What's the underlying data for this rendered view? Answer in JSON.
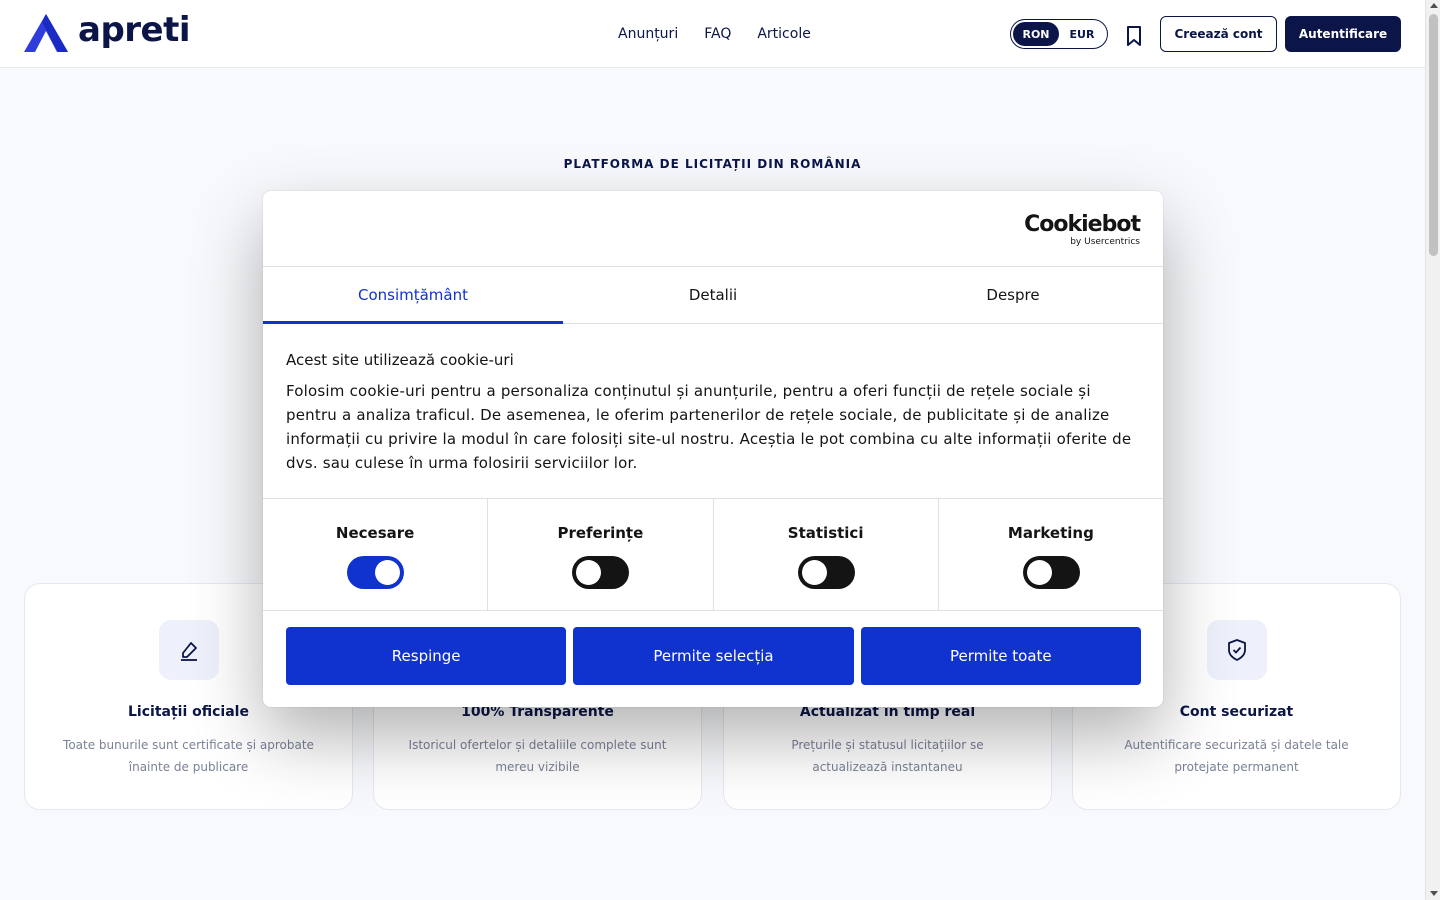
{
  "header": {
    "logo_text": "apreti",
    "nav": [
      "Anunțuri",
      "FAQ",
      "Articole"
    ],
    "currency": [
      "RON",
      "EUR"
    ],
    "currency_selected": "RON",
    "create_account": "Creează cont",
    "login": "Autentificare"
  },
  "hero": {
    "tagline": "PLATFORMA DE LICITAȚII DIN ROMÂNIA"
  },
  "features": [
    {
      "icon": "pen-icon",
      "title": "Licitații oficiale",
      "desc": "Toate bunurile sunt certificate și aprobate înainte de publicare"
    },
    {
      "icon": "eye-icon",
      "title": "100% Transparente",
      "desc": "Istoricul ofertelor și detaliile complete sunt mereu vizibile"
    },
    {
      "icon": "clock-icon",
      "title": "Actualizat în timp real",
      "desc": "Prețurile și statusul licitațiilor se actualizează instantaneu"
    },
    {
      "icon": "shield-check-icon",
      "title": "Cont securizat",
      "desc": "Autentificare securizată și datele tale protejate permanent"
    }
  ],
  "cookie": {
    "brand": "Cookiebot",
    "brand_sub": "by Usercentrics",
    "tabs": [
      "Consimțământ",
      "Detalii",
      "Despre"
    ],
    "active_tab": "Consimțământ",
    "heading": "Acest site utilizează cookie-uri",
    "text": "Folosim cookie-uri pentru a personaliza conținutul și anunțurile, pentru a oferi funcții de rețele sociale și pentru a analiza traficul. De asemenea, le oferim partenerilor de rețele sociale, de publicitate și de analize informații cu privire la modul în care folosiți site-ul nostru. Aceștia le pot combina cu alte informații oferite de dvs. sau culese în urma folosirii serviciilor lor.",
    "categories": [
      {
        "label": "Necesare",
        "enabled": true
      },
      {
        "label": "Preferințe",
        "enabled": false
      },
      {
        "label": "Statistici",
        "enabled": false
      },
      {
        "label": "Marketing",
        "enabled": false
      }
    ],
    "buttons": [
      "Respinge",
      "Permite selecția",
      "Permite toate"
    ]
  },
  "colors": {
    "brand_navy": "#0b1547",
    "cookie_blue": "#1032cf"
  }
}
